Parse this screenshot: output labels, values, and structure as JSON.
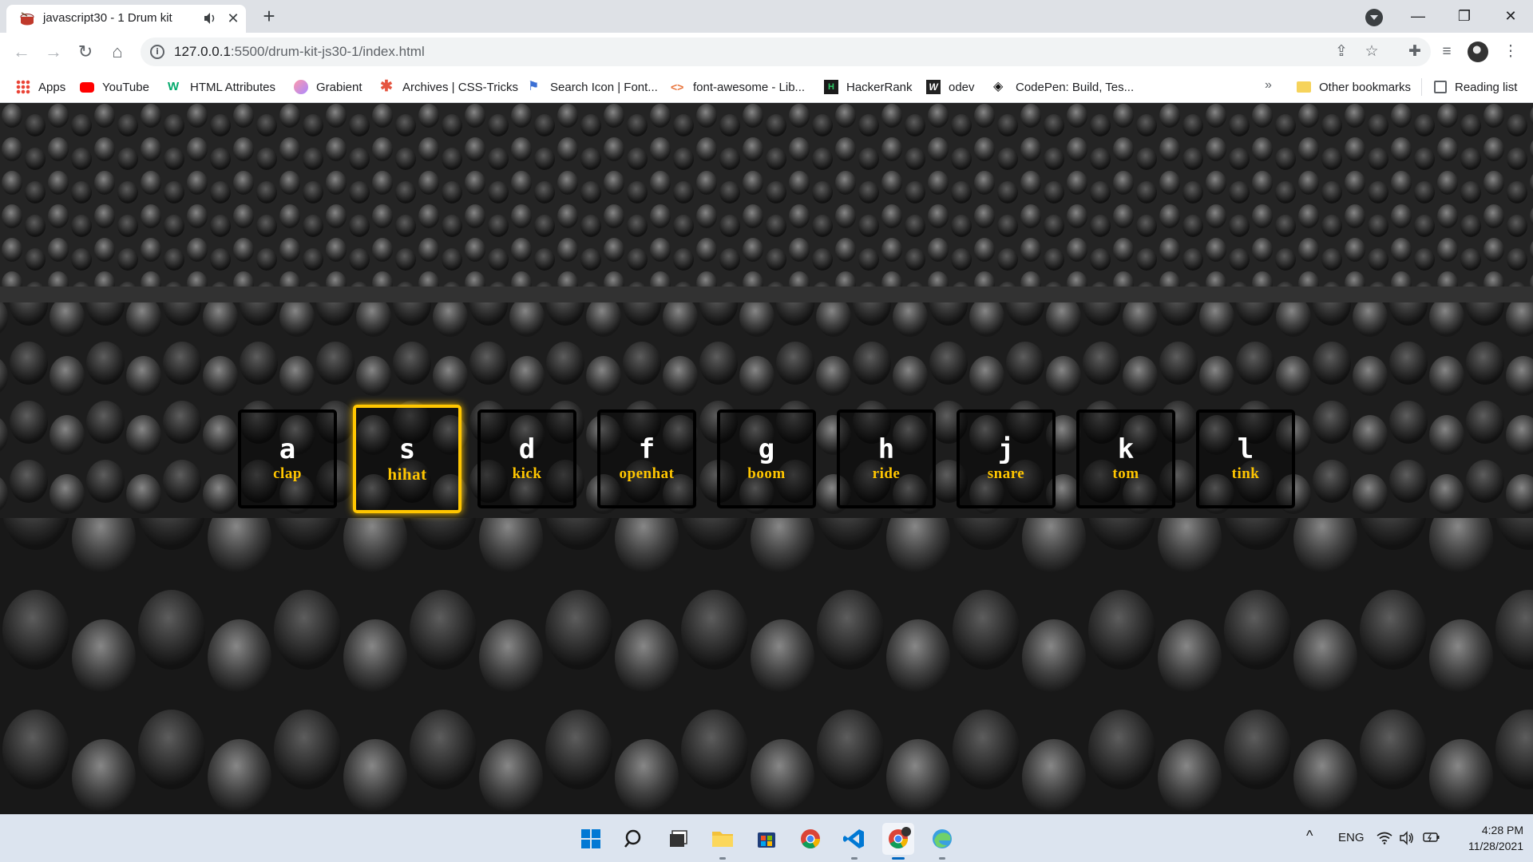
{
  "tab": {
    "title": "javascript30 - 1 Drum kit",
    "close": "✕",
    "new_tab": "+"
  },
  "window_controls": {
    "minimize": "—",
    "restore": "❐",
    "close": "✕"
  },
  "address_bar": {
    "host": "127.0.0.1",
    "path": ":5500/drum-kit-js30-1/index.html"
  },
  "nav": {
    "back": "←",
    "forward": "→",
    "reload": "↻",
    "home": "⌂"
  },
  "bookmarks": [
    {
      "label": "Apps",
      "icon": "apps-grid-icon"
    },
    {
      "label": "YouTube",
      "icon": "youtube-icon"
    },
    {
      "label": "HTML Attributes",
      "icon": "w3schools-icon"
    },
    {
      "label": "Grabient",
      "icon": "grabient-icon"
    },
    {
      "label": "Archives | CSS-Tricks",
      "icon": "css-tricks-icon"
    },
    {
      "label": "Search Icon | Font...",
      "icon": "flag-icon"
    },
    {
      "label": "font-awesome - Lib...",
      "icon": "code-brackets-icon"
    },
    {
      "label": "HackerRank",
      "icon": "hackerrank-icon"
    },
    {
      "label": "odev",
      "icon": "w-icon"
    },
    {
      "label": "CodePen: Build, Tes...",
      "icon": "codepen-icon"
    }
  ],
  "bookmarks_more": "»",
  "other_bookmarks": "Other bookmarks",
  "reading_list": "Reading list",
  "drum_keys": [
    {
      "key": "a",
      "sound": "clap",
      "playing": false
    },
    {
      "key": "s",
      "sound": "hihat",
      "playing": true
    },
    {
      "key": "d",
      "sound": "kick",
      "playing": false
    },
    {
      "key": "f",
      "sound": "openhat",
      "playing": false
    },
    {
      "key": "g",
      "sound": "boom",
      "playing": false
    },
    {
      "key": "h",
      "sound": "ride",
      "playing": false
    },
    {
      "key": "j",
      "sound": "snare",
      "playing": false
    },
    {
      "key": "k",
      "sound": "tom",
      "playing": false
    },
    {
      "key": "l",
      "sound": "tink",
      "playing": false
    }
  ],
  "colors": {
    "accent": "#ffc600",
    "key_border": "#000000"
  },
  "taskbar": {
    "apps": [
      "start-icon",
      "search-icon",
      "task-view-icon",
      "file-explorer-icon",
      "store-icon",
      "chrome-icon",
      "vscode-icon",
      "chrome-profile-icon",
      "edge-dev-icon"
    ],
    "tray_chevron": "^",
    "language": "ENG",
    "time": "4:28 PM",
    "date": "11/28/2021"
  }
}
